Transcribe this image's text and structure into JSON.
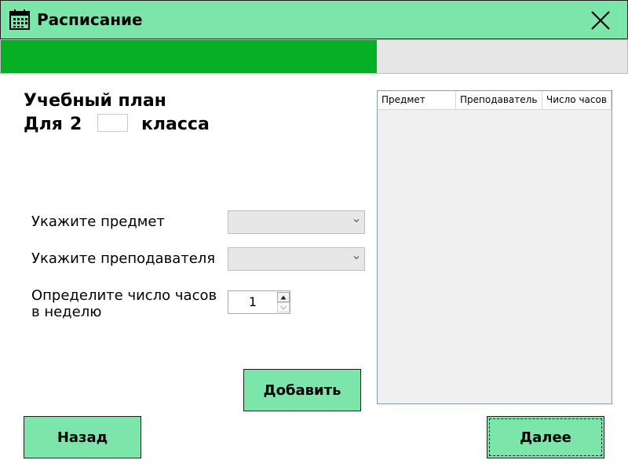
{
  "window": {
    "title": "Расписание",
    "accent_color": "#7ce6aa",
    "icons": {
      "app": "calendar-icon",
      "close": "close-icon"
    }
  },
  "progress": {
    "value_percent": 60,
    "fill_color": "#06b025"
  },
  "plan": {
    "heading": "Учебный план",
    "for_label": "Для",
    "grade": "2",
    "class_label": "класса",
    "class_input_value": ""
  },
  "form": {
    "subject_label": "Укажите предмет",
    "subject_value": "",
    "teacher_label": "Укажите преподавателя",
    "teacher_value": "",
    "hours_label_line1": "Определите число часов",
    "hours_label_line2": "в неделю",
    "hours_value": "1"
  },
  "buttons": {
    "add": "Добавить",
    "back": "Назад",
    "next": "Далее"
  },
  "table": {
    "columns": [
      "Предмет",
      "Преподаватель",
      "Число часов"
    ],
    "rows": []
  }
}
